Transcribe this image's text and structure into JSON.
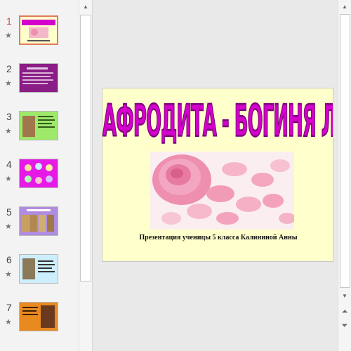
{
  "thumbnails": {
    "slides": [
      {
        "number": "1",
        "selected": true
      },
      {
        "number": "2",
        "selected": false
      },
      {
        "number": "3",
        "selected": false
      },
      {
        "number": "4",
        "selected": false
      },
      {
        "number": "5",
        "selected": false
      },
      {
        "number": "6",
        "selected": false
      },
      {
        "number": "7",
        "selected": false
      }
    ],
    "star_glyph": "★"
  },
  "slide": {
    "title": "АФРОДИТА - БОГИНЯ ЛЮБВИ И КРАСОТЫ",
    "subtitle": "Презентация ученицы 5 класса Калининой Анны",
    "background_color": "#ffffcc",
    "title_color": "#d400cc"
  },
  "scrollbars": {
    "up_arrow": "▲",
    "down_arrow": "▼",
    "prev_slide": "⏶",
    "next_slide": "⏷"
  }
}
